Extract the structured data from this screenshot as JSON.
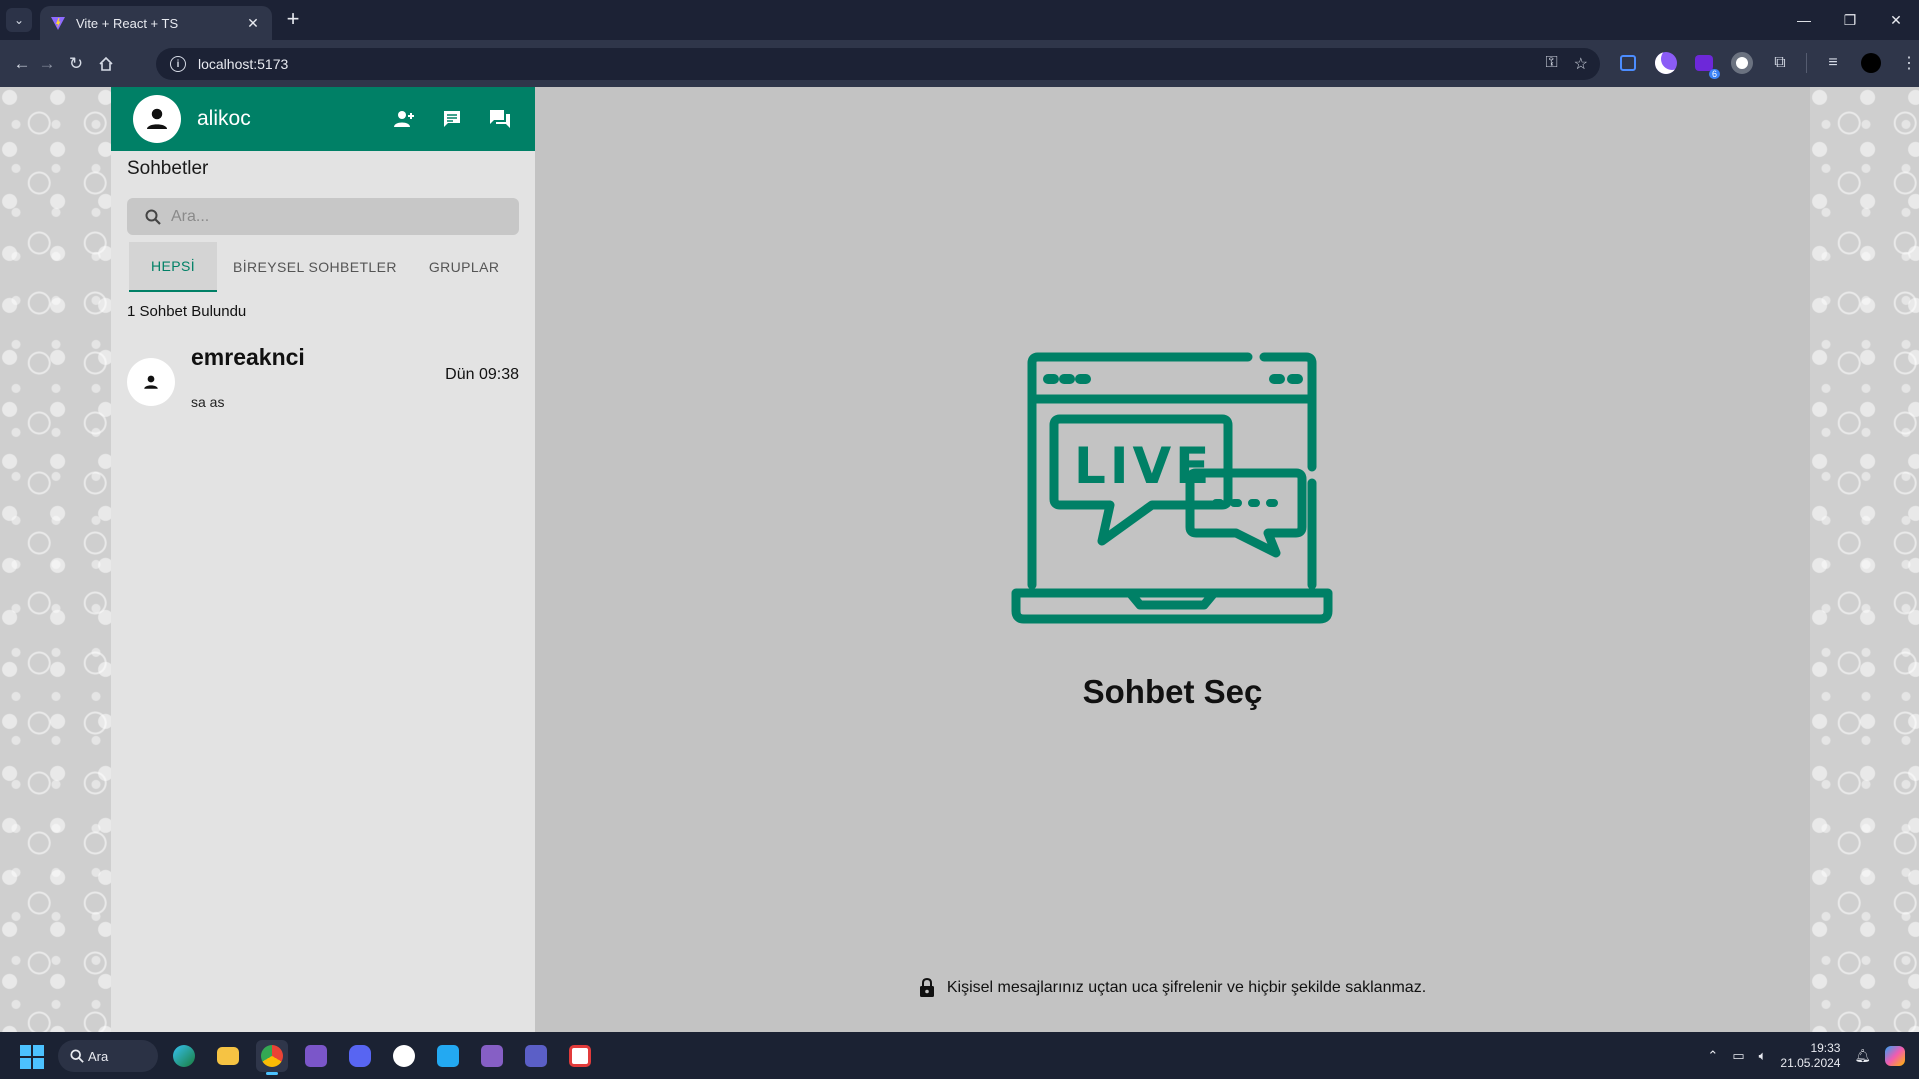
{
  "browser": {
    "tab_title": "Vite + React + TS",
    "url": "localhost:5173",
    "extension_badge": "6"
  },
  "app": {
    "username": "alikoc",
    "sidebar_title": "Sohbetler",
    "search_placeholder": "Ara...",
    "tabs": [
      {
        "label": "HEPSİ",
        "active": true
      },
      {
        "label": "BİREYSEL SOHBETLER",
        "active": false
      },
      {
        "label": "GRUPLAR",
        "active": false
      }
    ],
    "results_text": "1 Sohbet Bulundu",
    "chats": [
      {
        "name": "emreaknci",
        "time": "Dün 09:38",
        "last_message": "sa as"
      }
    ],
    "main": {
      "illustration_text": "LIVE",
      "title": "Sohbet Seç",
      "privacy_note": "Kişisel mesajlarınız uçtan uca şifrelenir ve hiçbir şekilde saklanmaz."
    },
    "colors": {
      "accent": "#008066",
      "main_bg": "#c3c3c3",
      "sidebar_bg": "#e3e3e3"
    }
  },
  "taskbar": {
    "search_label": "Ara",
    "time": "19:33",
    "date": "21.05.2024"
  }
}
